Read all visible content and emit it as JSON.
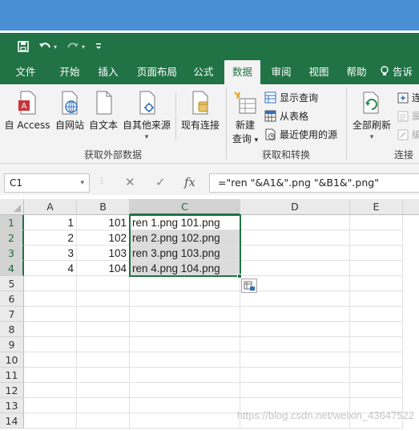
{
  "quick_access": {
    "save_icon": "save-icon",
    "undo_icon": "undo-icon",
    "redo_icon": "redo-icon",
    "customize_icon": "customize-qat-icon"
  },
  "tabs": [
    "文件",
    "开始",
    "插入",
    "页面布局",
    "公式",
    "数据",
    "审阅",
    "视图",
    "帮助",
    "告诉"
  ],
  "active_tab": "数据",
  "ribbon": {
    "get_external": {
      "buttons": [
        "自 Access",
        "自网站",
        "自文本",
        "自其他来源",
        "现有连接"
      ],
      "group_label": "获取外部数据"
    },
    "get_transform": {
      "new_query": [
        "新建",
        "查询"
      ],
      "show_queries": "显示查询",
      "from_table": "从表格",
      "recent_sources": "最近使用的源",
      "group_label": "获取和转换"
    },
    "connections": {
      "refresh_all": "全部刷新",
      "side_labels": [
        "连",
        "属",
        "编"
      ],
      "group_label": "连接"
    },
    "dropdown_marker": "▾"
  },
  "formula_bar": {
    "name_box": "C1",
    "cancel_symbol": "✕",
    "enter_symbol": "✓",
    "fx_symbol": "fx",
    "formula": "=\"ren \"&A1&\".png \"&B1&\".png\""
  },
  "sheet": {
    "columns": [
      "A",
      "B",
      "C",
      "D",
      "E"
    ],
    "rows": [
      "1",
      "2",
      "3",
      "4",
      "5",
      "6",
      "7",
      "8",
      "9",
      "10",
      "11",
      "12",
      "13",
      "14"
    ],
    "cells": [
      {
        "a": "1",
        "b": "101",
        "c": "ren 1.png 101.png"
      },
      {
        "a": "2",
        "b": "102",
        "c": "ren 2.png 102.png"
      },
      {
        "a": "3",
        "b": "103",
        "c": "ren 3.png 103.png"
      },
      {
        "a": "4",
        "b": "104",
        "c": "ren 4.png 104.png"
      }
    ],
    "selected_column": "C",
    "selected_rows": [
      "1",
      "2",
      "3",
      "4"
    ]
  },
  "watermark": "https://blog.csdn.net/weixin_43647522",
  "colors": {
    "excel_green": "#217346",
    "top_band": "#4a8fd4",
    "ribbon_bg": "#f3f3f3",
    "selection_shade": "#dcdcdc"
  }
}
